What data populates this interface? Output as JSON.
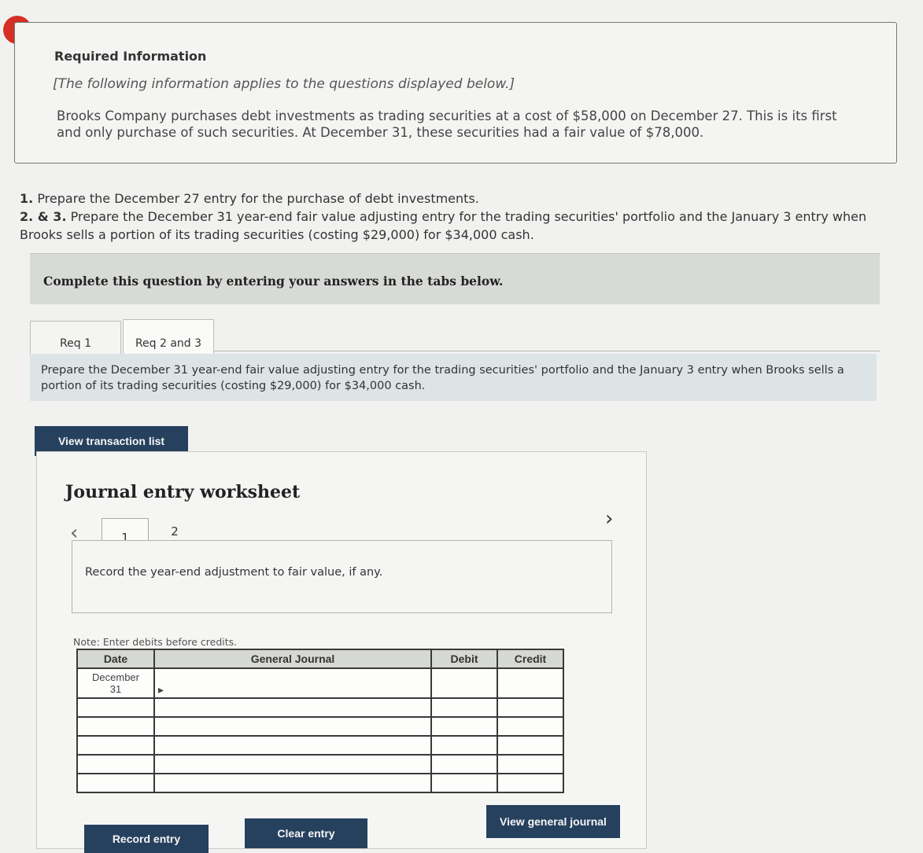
{
  "alert": {
    "symbol": "!"
  },
  "info": {
    "title": "Required Information",
    "subtitle": "[The following information applies to the questions displayed below.]",
    "body": "Brooks Company purchases debt investments as trading securities at a cost of $58,000 on December 27. This is its first and only purchase of such securities. At December 31, these securities had a fair value of $78,000."
  },
  "questions": {
    "q1_num": "1.",
    "q1_text": "Prepare the December 27 entry for the purchase of debt investments.",
    "q23_num": "2. & 3.",
    "q23_text": "Prepare the December 31 year-end fair value adjusting entry for the trading securities' portfolio and the January 3 entry when Brooks sells a portion of its trading securities (costing $29,000) for $34,000 cash."
  },
  "banner": {
    "text": "Complete this question by entering your answers in the tabs below."
  },
  "tabs": [
    {
      "label": "Req 1"
    },
    {
      "label": "Req 2 and 3"
    }
  ],
  "prompt": "Prepare the December 31 year-end fair value adjusting entry for the trading securities' portfolio and the January 3 entry when Brooks sells a portion of its trading securities (costing $29,000) for $34,000 cash.",
  "buttons": {
    "view_transaction_list": "View transaction list",
    "record_entry": "Record entry",
    "clear_entry": "Clear entry",
    "view_general_journal": "View general journal"
  },
  "worksheet": {
    "title": "Journal entry worksheet",
    "entry_tabs": [
      "1",
      "2"
    ],
    "entry_description": "Record the year-end adjustment to fair value, if any.",
    "note": "Note: Enter debits before credits.",
    "columns": {
      "date": "Date",
      "journal": "General Journal",
      "debit": "Debit",
      "credit": "Credit"
    },
    "first_date_month": "December",
    "first_date_day": "31"
  },
  "colors": {
    "button_bg": "#26415e",
    "alert": "#d62f25",
    "prompt_bg": "#dde4e6"
  }
}
